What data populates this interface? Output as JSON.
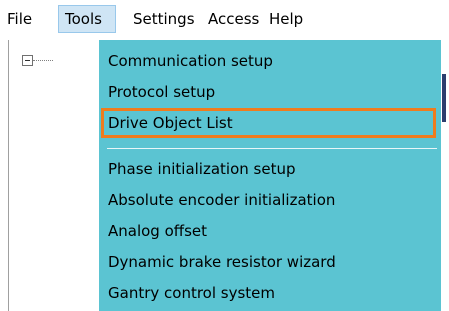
{
  "menubar": {
    "items": [
      {
        "label": "File"
      },
      {
        "label": "Tools"
      },
      {
        "label": "Settings"
      },
      {
        "label": "Access"
      },
      {
        "label": "Help"
      }
    ]
  },
  "tools_menu": {
    "items": [
      {
        "label": "Communication setup"
      },
      {
        "label": "Protocol setup"
      },
      {
        "label": "Drive Object List"
      },
      {
        "label": "Phase initialization setup"
      },
      {
        "label": "Absolute encoder initialization"
      },
      {
        "label": "Analog offset"
      },
      {
        "label": "Dynamic brake resistor wizard"
      },
      {
        "label": "Gantry control system"
      }
    ],
    "highlighted_item": "Drive Object List"
  },
  "colors": {
    "menu_background": "#5bc4d2",
    "highlight_border": "#ef7c1e",
    "active_menu_background": "#cfe5f5"
  },
  "icons": {
    "tree_toggle": "tree-collapse-icon"
  }
}
